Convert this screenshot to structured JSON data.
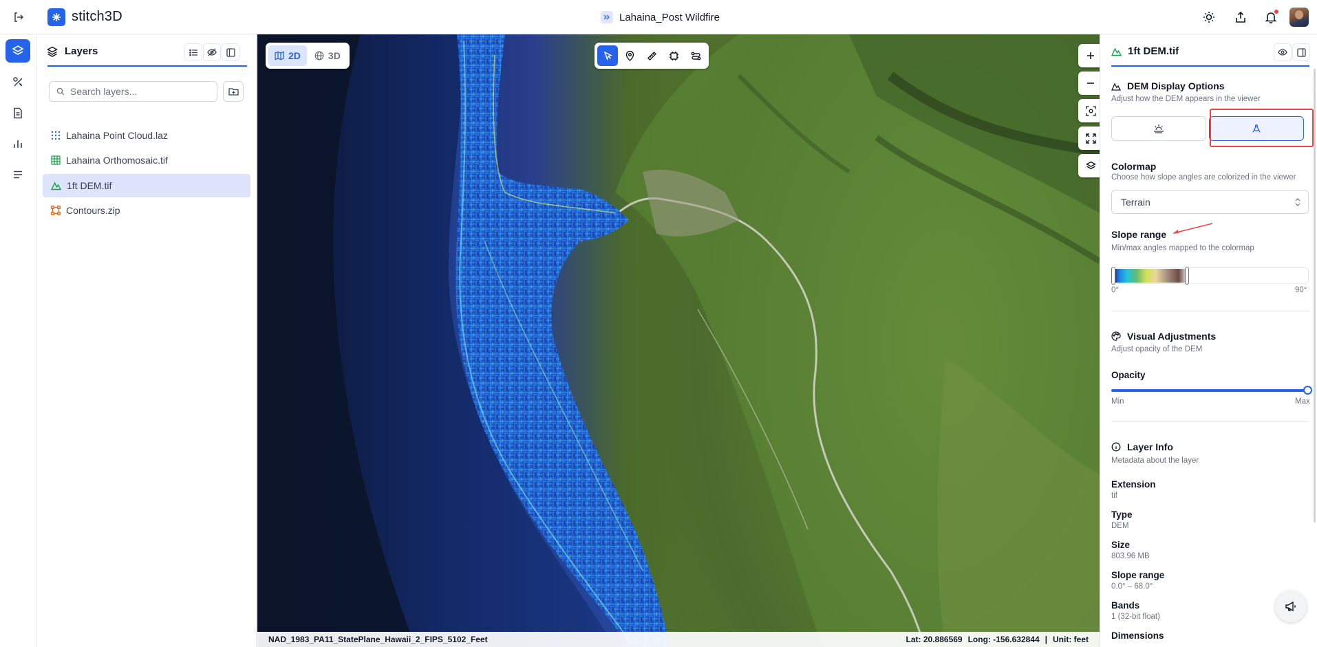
{
  "app": {
    "name": "stitch3D",
    "project_title": "Lahaina_Post Wildfire"
  },
  "layers_panel": {
    "title": "Layers",
    "search_placeholder": "Search layers...",
    "items": [
      {
        "label": "Lahaina Point Cloud.laz",
        "icon": "point-cloud-icon",
        "color": "#2563eb"
      },
      {
        "label": "Lahaina Orthomosaic.tif",
        "icon": "grid-raster-icon",
        "color": "#16a34a"
      },
      {
        "label": "1ft DEM.tif",
        "icon": "terrain-icon",
        "color": "#16a34a",
        "selected": true
      },
      {
        "label": "Contours.zip",
        "icon": "vector-shape-icon",
        "color": "#ea580c"
      }
    ]
  },
  "map": {
    "view_modes": [
      {
        "label": "2D",
        "active": true
      },
      {
        "label": "3D",
        "active": false
      }
    ],
    "status_left": "NAD_1983_PA11_StatePlane_Hawaii_2_FIPS_5102_Feet",
    "lat": "Lat: 20.886569",
    "long": "Long: -156.632844",
    "separator": "|",
    "unit": "Unit: feet"
  },
  "properties_panel": {
    "title": "1ft DEM.tif",
    "dem_section": {
      "title": "DEM Display Options",
      "subtitle": "Adjust how the DEM appears in the viewer",
      "active_mode": "slope"
    },
    "colormap": {
      "title": "Colormap",
      "subtitle": "Choose how slope angles are colorized in the viewer",
      "selected": "Terrain"
    },
    "slope_range": {
      "title": "Slope range",
      "subtitle": "Min/max angles mapped to the colormap",
      "min_label": "0°",
      "max_label": "90°",
      "min_value": 0,
      "max_value": 40
    },
    "visual": {
      "title": "Visual Adjustments",
      "subtitle": "Adjust opacity of the DEM",
      "opacity_label": "Opacity",
      "min_label": "Min",
      "max_label": "Max",
      "opacity": 1.0
    },
    "layer_info": {
      "title": "Layer Info",
      "subtitle": "Metadata about the layer",
      "fields": [
        {
          "label": "Extension",
          "value": "tif"
        },
        {
          "label": "Type",
          "value": "DEM"
        },
        {
          "label": "Size",
          "value": "803.96 MB"
        },
        {
          "label": "Slope range",
          "value": "0.0° – 68.0°"
        },
        {
          "label": "Bands",
          "value": "1 (32-bit float)"
        },
        {
          "label": "Dimensions",
          "value": ""
        }
      ]
    }
  },
  "colors": {
    "accent": "#2563eb",
    "highlight": "#ef4444"
  }
}
